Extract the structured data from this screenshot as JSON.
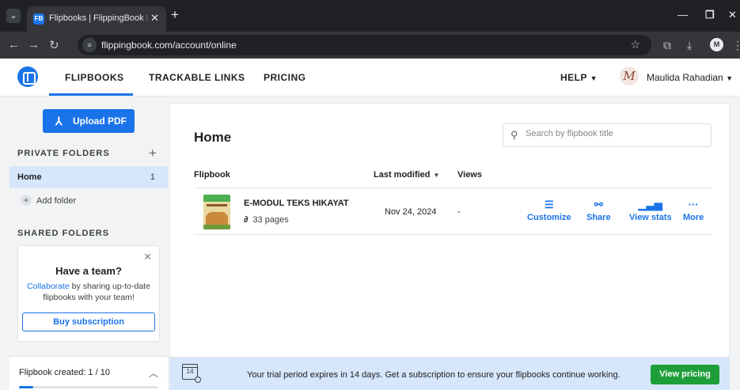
{
  "browser": {
    "tab_title": "Flipbooks | FlippingBook Personal",
    "url": "flippingbook.com/account/online",
    "favicon": "FB",
    "profile_initial": "M"
  },
  "header": {
    "nav": [
      "FLIPBOOKS",
      "TRACKABLE LINKS",
      "PRICING"
    ],
    "help_label": "HELP",
    "user_name": "Maulida Rahadian",
    "avatar_letter": "M"
  },
  "sidebar": {
    "upload_label": "Upload PDF",
    "private_title": "PRIVATE FOLDERS",
    "folders": [
      {
        "name": "Home",
        "count": "1"
      }
    ],
    "add_folder_label": "Add folder",
    "shared_title": "SHARED FOLDERS",
    "team_card": {
      "title": "Have a team?",
      "link_text": "Collaborate",
      "desc_rest": " by sharing up-to-date flipbooks with your team!",
      "button": "Buy subscription"
    },
    "created": {
      "label": "Flipbook created: 1 / 10",
      "progress": 0.1
    }
  },
  "main": {
    "title": "Home",
    "search_placeholder": "Search by flipbook title",
    "columns": [
      "Flipbook",
      "Last modified",
      "Views"
    ],
    "rows": [
      {
        "name": "E-MODUL TEKS HIKAYAT",
        "pages": "33 pages",
        "modified": "Nov 24, 2024",
        "views": "-"
      }
    ],
    "actions": [
      "Customize",
      "Share",
      "View stats",
      "More"
    ]
  },
  "banner": {
    "calendar_day": "14",
    "message": "Your trial period expires in 14 days. Get a subscription to ensure your flipbooks continue working.",
    "cta": "View pricing"
  },
  "colors": {
    "accent": "#1a73e8",
    "cta_green": "#1e9e3a",
    "selected_folder": "#d6e6fb"
  }
}
